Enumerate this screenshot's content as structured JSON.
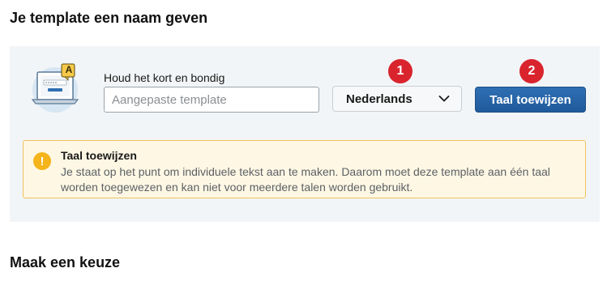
{
  "headings": {
    "top": "Je template een naam geven",
    "bottom": "Maak een keuze"
  },
  "name_field": {
    "label": "Houd het kort en bondig",
    "placeholder": "Aangepaste template",
    "value": ""
  },
  "language_select": {
    "selected": "Nederlands"
  },
  "assign_button": {
    "label": "Taal toewijzen"
  },
  "badges": [
    "1",
    "2"
  ],
  "warning": {
    "icon": "!",
    "title": "Taal toewijzen",
    "text": "Je staat op het punt om individuele tekst aan te maken. Daarom moet deze template aan één taal worden toegewezen en kan niet voor meerdere talen worden gebruikt."
  },
  "illustration": {
    "badge_letter": "A"
  },
  "colors": {
    "panel_bg": "#f2f5f7",
    "button_blue": "#1f5a9b",
    "badge_red": "#d9242e",
    "warning_bg": "#fef7e4",
    "warning_border": "#f0c25c",
    "warning_icon": "#f4b41a"
  }
}
